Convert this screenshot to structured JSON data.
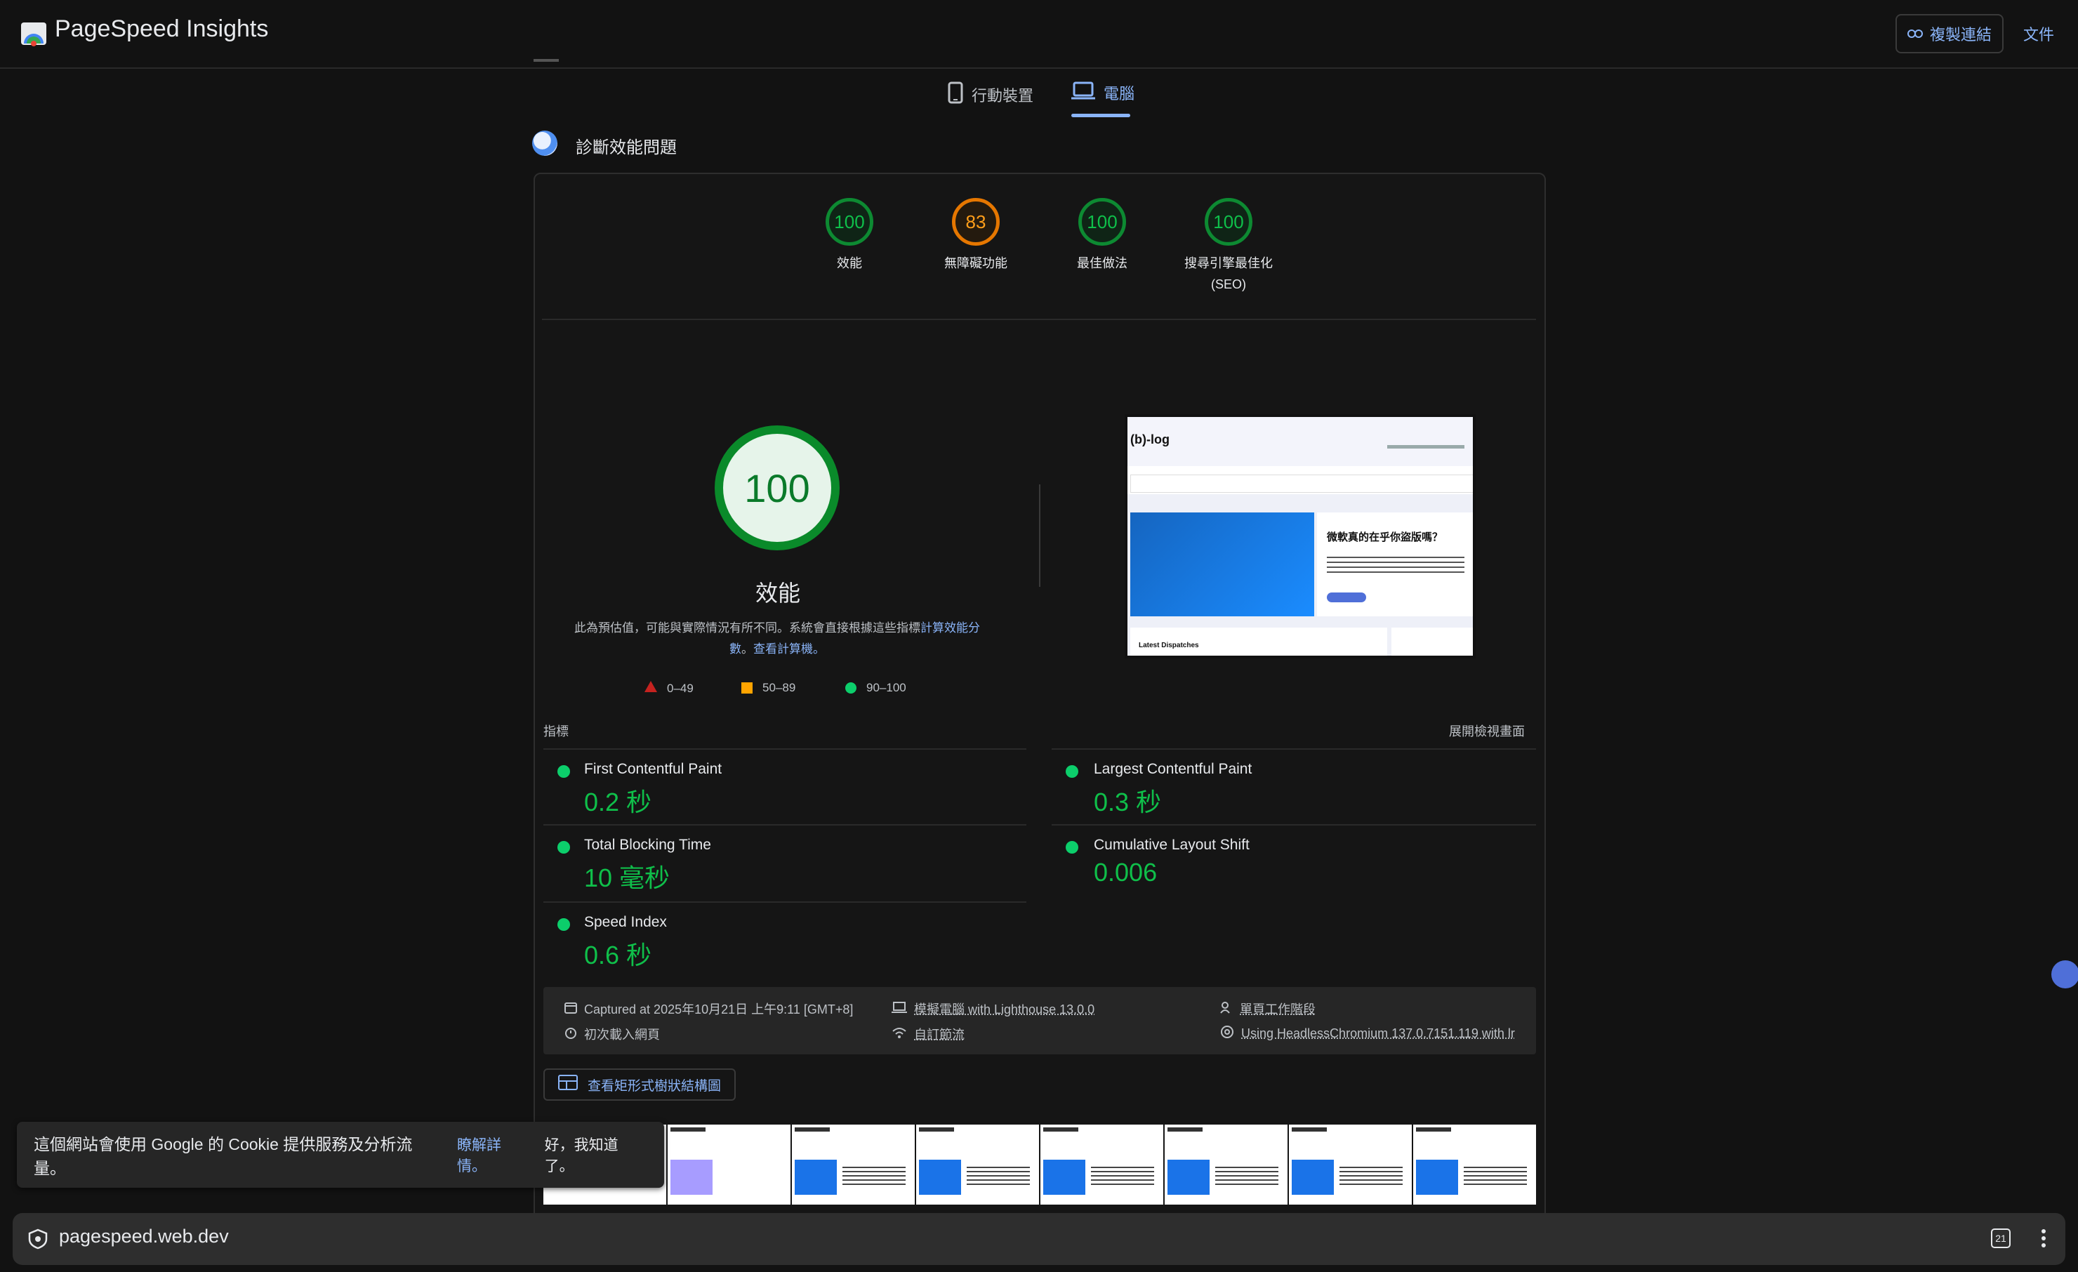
{
  "header": {
    "app_title": "PageSpeed Insights",
    "copy_link": "複製連結",
    "docs": "文件"
  },
  "device_tabs": {
    "mobile": "行動裝置",
    "desktop": "電腦"
  },
  "section_title": "診斷效能問題",
  "category_scores": [
    {
      "score": "100",
      "label": "效能"
    },
    {
      "score": "83",
      "label": "無障礙功能"
    },
    {
      "score": "100",
      "label": "最佳做法"
    },
    {
      "score": "100",
      "label": "搜尋引擎最佳化",
      "label2": "(SEO)"
    }
  ],
  "performance": {
    "score": "100",
    "title": "效能",
    "desc_text": "此為預估值，可能與實際情況有所不同。系統會直接根據這些指標",
    "desc_link1": "計算效能分數",
    "desc_sep": "。",
    "desc_link2": "查看計算機。"
  },
  "legend": {
    "fail": "0–49",
    "average": "50–89",
    "pass": "90–100"
  },
  "metrics_header": "指標",
  "expand_view": "展開檢視畫面",
  "metrics": {
    "fcp": {
      "name": "First Contentful Paint",
      "value": "0.2 秒"
    },
    "lcp": {
      "name": "Largest Contentful Paint",
      "value": "0.3 秒"
    },
    "tbt": {
      "name": "Total Blocking Time",
      "value": "10 毫秒"
    },
    "cls": {
      "name": "Cumulative Layout Shift",
      "value": "0.006"
    },
    "si": {
      "name": "Speed Index",
      "value": "0.6 秒"
    }
  },
  "run_info": {
    "captured": "Captured at 2025年10月21日 上午9:11 [GMT+8]",
    "emulated": "模擬電腦 with Lighthouse 13.0.0",
    "session": "單頁工作階段",
    "load": "初次載入網頁",
    "throttle": "自訂節流",
    "browser": "Using HeadlessChromium 137.0.7151.119 with lr"
  },
  "treemap_button": "查看矩形式樹狀結構圖",
  "site_screenshot": {
    "brand": "(b)-log",
    "headline": "微軟真的在乎你盜版嗎？",
    "section": "Latest Dispatches"
  },
  "cookie_banner": {
    "text": "這個網站會使用 Google 的 Cookie 提供服務及分析流量。",
    "learn_more": "瞭解詳情。",
    "ok": "好，我知道了。"
  },
  "url_bar": {
    "url": "pagespeed.web.dev",
    "tab_count": "21"
  },
  "colors": {
    "pass": "#0cce6b",
    "average": "#ffa400",
    "fail": "#c5221f",
    "accent": "#8ab4f8"
  }
}
